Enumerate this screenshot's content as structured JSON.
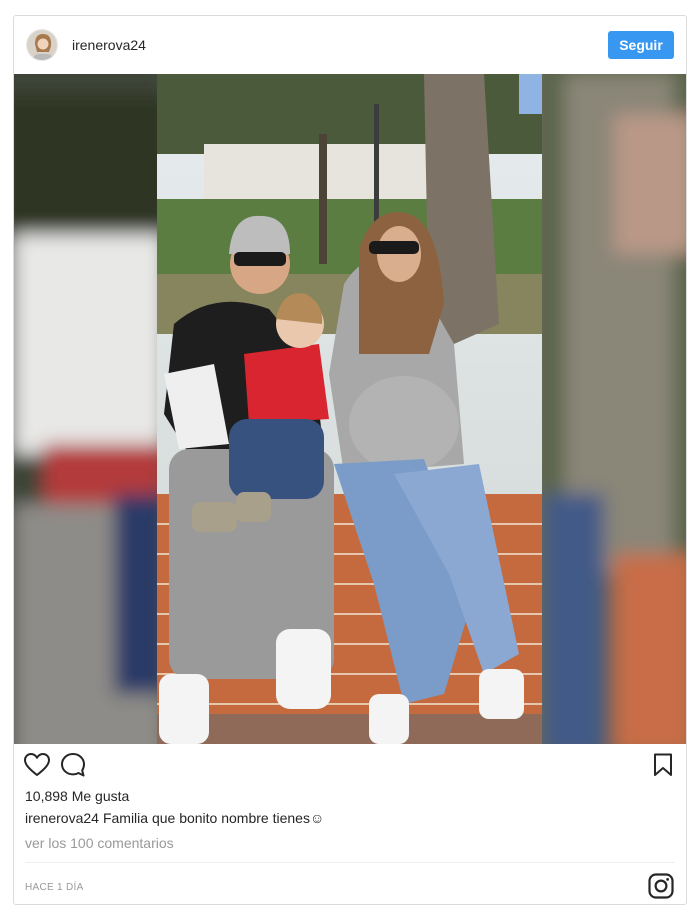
{
  "post": {
    "username": "irenerova24",
    "follow_label": "Seguir",
    "likes_text": "10,898 Me gusta",
    "caption_user": "irenerova24",
    "caption_text": "Familia que bonito nombre tienes☺",
    "comments_link": "ver los 100 comentarios",
    "timestamp": "HACE 1 DÍA"
  },
  "icons": {
    "like": "heart-icon",
    "comment": "comment-bubble-icon",
    "save": "bookmark-icon",
    "brand": "instagram-icon"
  },
  "colors": {
    "follow_button": "#3897f0",
    "text": "#262626",
    "muted": "#999999",
    "border": "#dbdbdb"
  }
}
